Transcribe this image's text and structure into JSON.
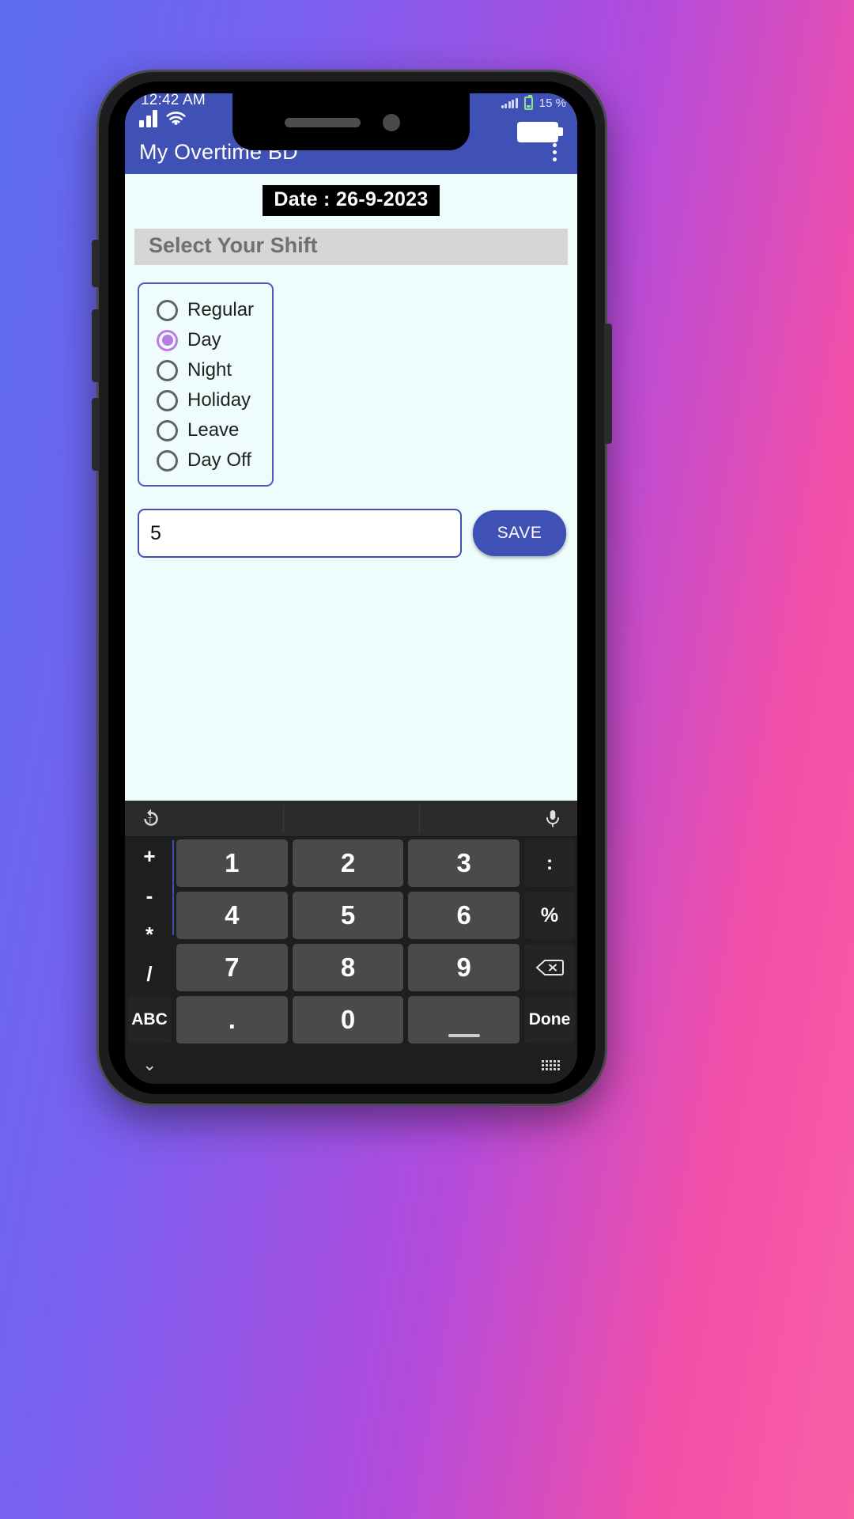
{
  "status_bar": {
    "clock": "12:42 AM",
    "battery_percent": "15 %",
    "signal_icon": "signal-bars-icon",
    "wifi_icon": "wifi-icon",
    "battery_icon": "battery-icon"
  },
  "app_bar": {
    "title": "My Overtime BD",
    "overflow_icon": "overflow-menu-icon"
  },
  "content": {
    "date_banner": "Date : 26-9-2023",
    "shift_header": "Select Your Shift",
    "shift_options": [
      {
        "label": "Regular",
        "checked": false
      },
      {
        "label": "Day",
        "checked": true
      },
      {
        "label": "Night",
        "checked": false
      },
      {
        "label": "Holiday",
        "checked": false
      },
      {
        "label": "Leave",
        "checked": false
      },
      {
        "label": "Day Off",
        "checked": false
      }
    ],
    "selected_shift": "Day",
    "input_value": "5",
    "input_placeholder": "",
    "save_label": "SAVE"
  },
  "keyboard": {
    "suggestion_left_icon": "clipboard-history-icon",
    "suggestion_right_icon": "microphone-icon",
    "keys": {
      "plus": "+",
      "minus": "-",
      "multiply": "*",
      "divide": "/",
      "one": "1",
      "two": "2",
      "three": "3",
      "four": "4",
      "five": "5",
      "six": "6",
      "seven": "7",
      "eight": "8",
      "nine": "9",
      "zero": "0",
      "colon": ":",
      "percent": "%",
      "backspace": "backspace-icon",
      "abc": "ABC",
      "dot": ".",
      "space": "space-icon",
      "done": "Done"
    },
    "bottom_bar": {
      "hide_icon": "chevron-down-icon",
      "switch_icon": "keyboard-switch-icon"
    }
  },
  "theme": {
    "primary": "#3f51b5",
    "accent_radio": "#b97ae8",
    "app_background": "#eefcfb",
    "header_bar": "#d6d6d6",
    "keyboard_bg": "#1e1e1e"
  }
}
